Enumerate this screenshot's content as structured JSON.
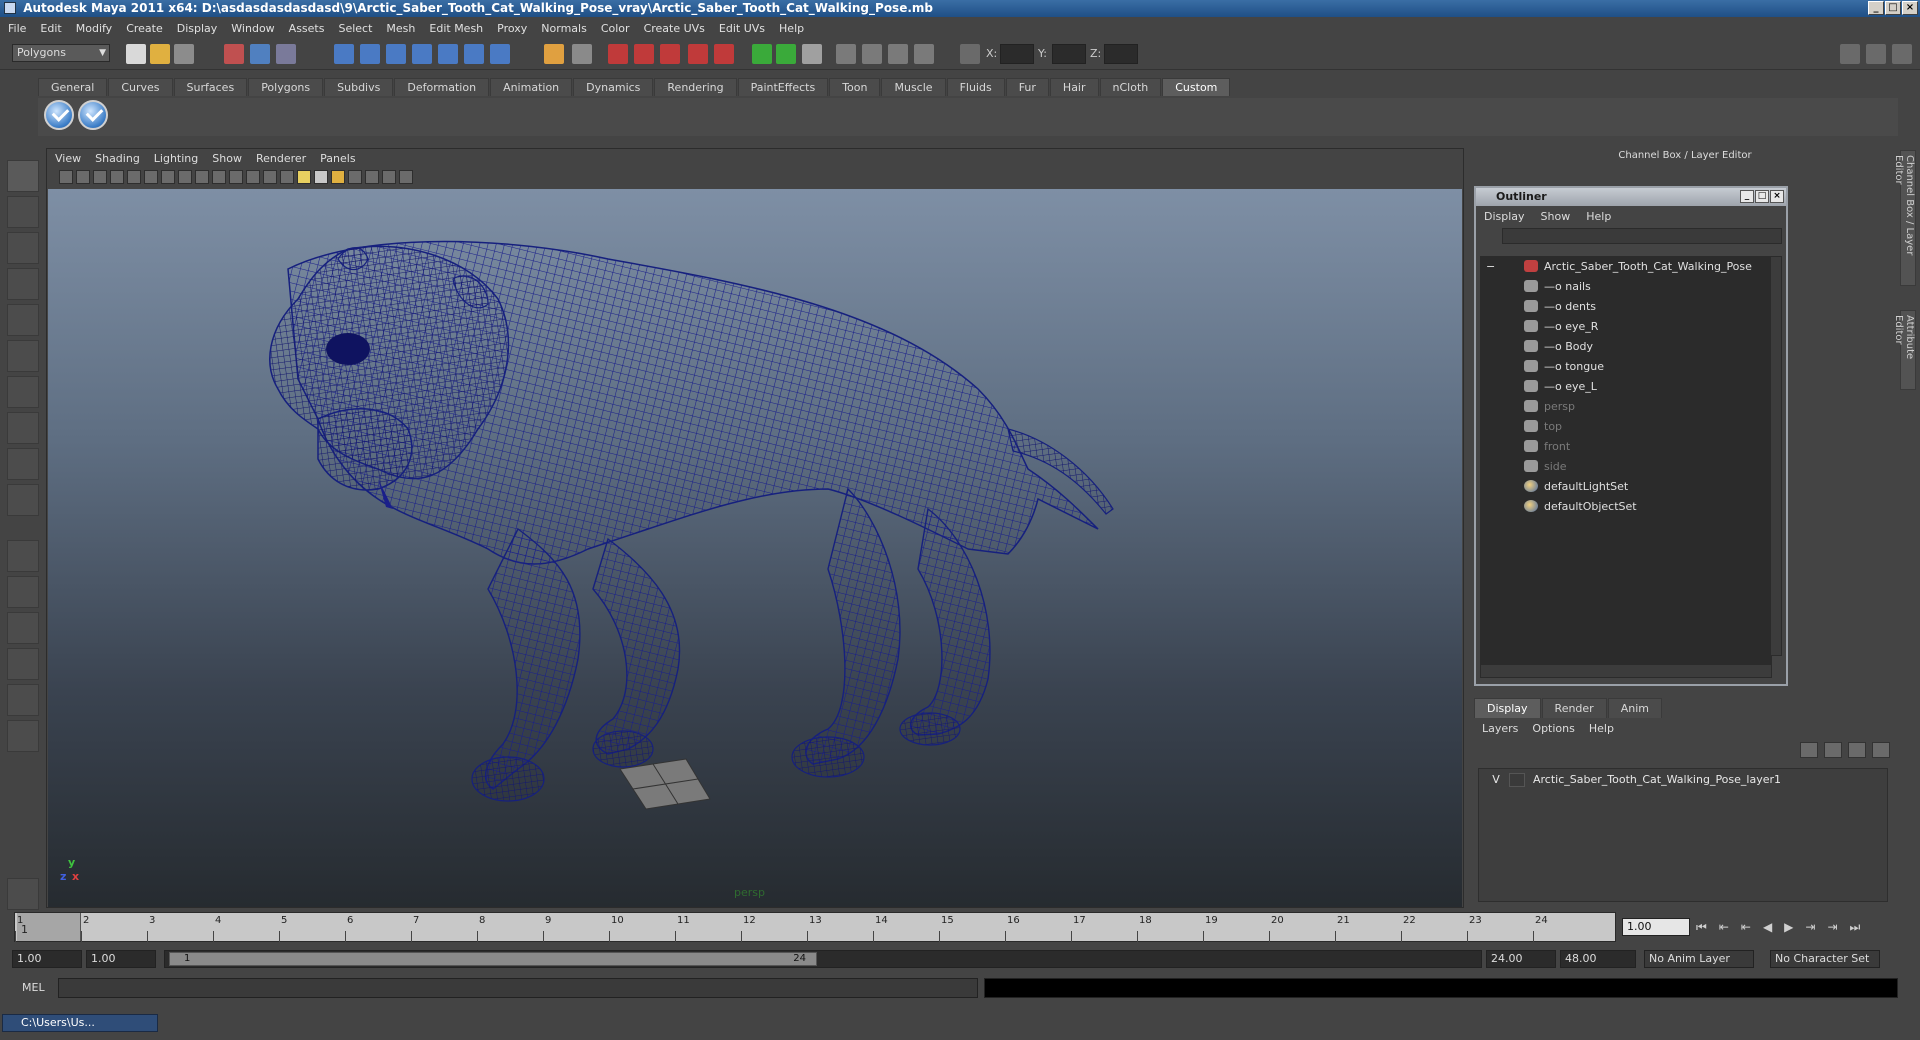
{
  "window": {
    "title": "Autodesk Maya 2011 x64: D:\\asdasdasdasdasd\\9\\Arctic_Saber_Tooth_Cat_Walking_Pose_vray\\Arctic_Saber_Tooth_Cat_Walking_Pose.mb",
    "min": "_",
    "max": "□",
    "close": "×"
  },
  "menubar": [
    "File",
    "Edit",
    "Modify",
    "Create",
    "Display",
    "Window",
    "Assets",
    "Select",
    "Mesh",
    "Edit Mesh",
    "Proxy",
    "Normals",
    "Color",
    "Create UVs",
    "Edit UVs",
    "Help"
  ],
  "status": {
    "mode": "Polygons",
    "x": "X:",
    "y": "Y:",
    "z": "Z:"
  },
  "shelf": {
    "tabs": [
      "General",
      "Curves",
      "Surfaces",
      "Polygons",
      "Subdivs",
      "Deformation",
      "Animation",
      "Dynamics",
      "Rendering",
      "PaintEffects",
      "Toon",
      "Muscle",
      "Fluids",
      "Fur",
      "Hair",
      "nCloth",
      "Custom"
    ],
    "active_tab": "Custom"
  },
  "viewport": {
    "menu": [
      "View",
      "Shading",
      "Lighting",
      "Show",
      "Renderer",
      "Panels"
    ],
    "camera_label": "persp",
    "axis": {
      "y": "y",
      "x": "x",
      "z": "z"
    }
  },
  "channel_box": {
    "title": "Channel Box / Layer Editor"
  },
  "side_tabs": [
    "Channel Box / Layer Editor",
    "Attribute Editor"
  ],
  "outliner": {
    "title": "Outliner",
    "menu": [
      "Display",
      "Show",
      "Help"
    ],
    "root": "Arctic_Saber_Tooth_Cat_Walking_Pose",
    "children": [
      "nails",
      "dents",
      "eye_R",
      "Body",
      "tongue",
      "eye_L"
    ],
    "cameras": [
      "persp",
      "top",
      "front",
      "side"
    ],
    "sets": [
      "defaultLightSet",
      "defaultObjectSet"
    ],
    "expand": "−"
  },
  "layer_editor": {
    "tabs": [
      "Display",
      "Render",
      "Anim"
    ],
    "active_tab": "Display",
    "menu": [
      "Layers",
      "Options",
      "Help"
    ],
    "layer": {
      "visible": "V",
      "name": "Arctic_Saber_Tooth_Cat_Walking_Pose_layer1"
    }
  },
  "timeslider": {
    "ticks": [
      "1",
      "2",
      "3",
      "4",
      "5",
      "6",
      "7",
      "8",
      "9",
      "10",
      "11",
      "12",
      "13",
      "14",
      "15",
      "16",
      "17",
      "18",
      "19",
      "20",
      "21",
      "22",
      "23",
      "24"
    ],
    "current_frame": "1.00",
    "start_marker": "1"
  },
  "playback": [
    "⏮",
    "⇤",
    "⇤",
    "◀",
    "▶",
    "⇥",
    "⇥",
    "⏭"
  ],
  "range": {
    "start_time": "1.00",
    "playback_start": "1.00",
    "handle_start": "1",
    "handle_end": "24",
    "playback_end": "24.00",
    "end_time": "48.00",
    "anim_layer": "No Anim Layer",
    "character_set": "No Character Set"
  },
  "command": {
    "label": "MEL"
  },
  "taskbar": {
    "item": "C:\\Users\\Us..."
  }
}
